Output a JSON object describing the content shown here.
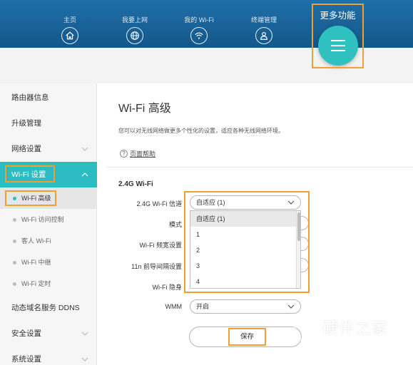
{
  "nav": {
    "items": [
      {
        "label": "主页",
        "icon": "home-icon"
      },
      {
        "label": "我要上网",
        "icon": "globe-icon"
      },
      {
        "label": "我的 Wi-Fi",
        "icon": "wifi-icon"
      },
      {
        "label": "终端管理",
        "icon": "user-icon"
      }
    ],
    "more_label": "更多功能",
    "more_icon": "hamburger-menu-icon"
  },
  "sidebar": {
    "router_info": "路由器信息",
    "upgrade": "升级管理",
    "network": "网络设置",
    "wifi_settings": "Wi-Fi 设置",
    "sub_items": [
      "Wi-Fi 高级",
      "Wi-Fi 访问控制",
      "客人 Wi-Fi",
      "Wi-Fi 中继",
      "Wi-Fi 定时"
    ],
    "ddns": "动态域名服务 DDNS",
    "security": "安全设置",
    "system": "系统设置"
  },
  "main": {
    "title": "Wi-Fi 高级",
    "description": "您可以对无线网络做更多个性化的设置，适应各种无线网络环境。",
    "help": "页面帮助",
    "section": "2.4G Wi-Fi",
    "rows": {
      "channel_label": "2.4G Wi-Fi 信道",
      "channel_value": "自适应 (1)",
      "mode_label": "模式",
      "bandwidth_label": "Wi-Fi 频宽设置",
      "guard_label": "11n 前导间隔设置",
      "hidden_label": "Wi-Fi 隐身",
      "wmm_label": "WMM",
      "wmm_value": "开启"
    },
    "dropdown_options": [
      "自适应 (1)",
      "1",
      "2",
      "3",
      "4"
    ],
    "save": "保存"
  },
  "watermark": {
    "text": "硬件之家",
    "sub": "YING JIAN ZHI JIA.COM"
  },
  "colors": {
    "header": "#1a64a0",
    "accent": "#2dbcc1",
    "highlight": "#f0a030"
  }
}
